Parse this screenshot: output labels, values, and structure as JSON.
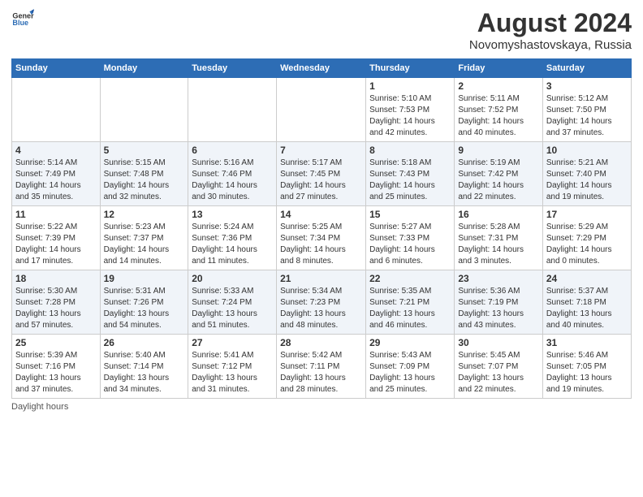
{
  "header": {
    "logo_line1": "General",
    "logo_line2": "Blue",
    "month_year": "August 2024",
    "location": "Novomyshastovskaya, Russia"
  },
  "days_of_week": [
    "Sunday",
    "Monday",
    "Tuesday",
    "Wednesday",
    "Thursday",
    "Friday",
    "Saturday"
  ],
  "weeks": [
    [
      {
        "day": "",
        "info": ""
      },
      {
        "day": "",
        "info": ""
      },
      {
        "day": "",
        "info": ""
      },
      {
        "day": "",
        "info": ""
      },
      {
        "day": "1",
        "info": "Sunrise: 5:10 AM\nSunset: 7:53 PM\nDaylight: 14 hours\nand 42 minutes."
      },
      {
        "day": "2",
        "info": "Sunrise: 5:11 AM\nSunset: 7:52 PM\nDaylight: 14 hours\nand 40 minutes."
      },
      {
        "day": "3",
        "info": "Sunrise: 5:12 AM\nSunset: 7:50 PM\nDaylight: 14 hours\nand 37 minutes."
      }
    ],
    [
      {
        "day": "4",
        "info": "Sunrise: 5:14 AM\nSunset: 7:49 PM\nDaylight: 14 hours\nand 35 minutes."
      },
      {
        "day": "5",
        "info": "Sunrise: 5:15 AM\nSunset: 7:48 PM\nDaylight: 14 hours\nand 32 minutes."
      },
      {
        "day": "6",
        "info": "Sunrise: 5:16 AM\nSunset: 7:46 PM\nDaylight: 14 hours\nand 30 minutes."
      },
      {
        "day": "7",
        "info": "Sunrise: 5:17 AM\nSunset: 7:45 PM\nDaylight: 14 hours\nand 27 minutes."
      },
      {
        "day": "8",
        "info": "Sunrise: 5:18 AM\nSunset: 7:43 PM\nDaylight: 14 hours\nand 25 minutes."
      },
      {
        "day": "9",
        "info": "Sunrise: 5:19 AM\nSunset: 7:42 PM\nDaylight: 14 hours\nand 22 minutes."
      },
      {
        "day": "10",
        "info": "Sunrise: 5:21 AM\nSunset: 7:40 PM\nDaylight: 14 hours\nand 19 minutes."
      }
    ],
    [
      {
        "day": "11",
        "info": "Sunrise: 5:22 AM\nSunset: 7:39 PM\nDaylight: 14 hours\nand 17 minutes."
      },
      {
        "day": "12",
        "info": "Sunrise: 5:23 AM\nSunset: 7:37 PM\nDaylight: 14 hours\nand 14 minutes."
      },
      {
        "day": "13",
        "info": "Sunrise: 5:24 AM\nSunset: 7:36 PM\nDaylight: 14 hours\nand 11 minutes."
      },
      {
        "day": "14",
        "info": "Sunrise: 5:25 AM\nSunset: 7:34 PM\nDaylight: 14 hours\nand 8 minutes."
      },
      {
        "day": "15",
        "info": "Sunrise: 5:27 AM\nSunset: 7:33 PM\nDaylight: 14 hours\nand 6 minutes."
      },
      {
        "day": "16",
        "info": "Sunrise: 5:28 AM\nSunset: 7:31 PM\nDaylight: 14 hours\nand 3 minutes."
      },
      {
        "day": "17",
        "info": "Sunrise: 5:29 AM\nSunset: 7:29 PM\nDaylight: 14 hours\nand 0 minutes."
      }
    ],
    [
      {
        "day": "18",
        "info": "Sunrise: 5:30 AM\nSunset: 7:28 PM\nDaylight: 13 hours\nand 57 minutes."
      },
      {
        "day": "19",
        "info": "Sunrise: 5:31 AM\nSunset: 7:26 PM\nDaylight: 13 hours\nand 54 minutes."
      },
      {
        "day": "20",
        "info": "Sunrise: 5:33 AM\nSunset: 7:24 PM\nDaylight: 13 hours\nand 51 minutes."
      },
      {
        "day": "21",
        "info": "Sunrise: 5:34 AM\nSunset: 7:23 PM\nDaylight: 13 hours\nand 48 minutes."
      },
      {
        "day": "22",
        "info": "Sunrise: 5:35 AM\nSunset: 7:21 PM\nDaylight: 13 hours\nand 46 minutes."
      },
      {
        "day": "23",
        "info": "Sunrise: 5:36 AM\nSunset: 7:19 PM\nDaylight: 13 hours\nand 43 minutes."
      },
      {
        "day": "24",
        "info": "Sunrise: 5:37 AM\nSunset: 7:18 PM\nDaylight: 13 hours\nand 40 minutes."
      }
    ],
    [
      {
        "day": "25",
        "info": "Sunrise: 5:39 AM\nSunset: 7:16 PM\nDaylight: 13 hours\nand 37 minutes."
      },
      {
        "day": "26",
        "info": "Sunrise: 5:40 AM\nSunset: 7:14 PM\nDaylight: 13 hours\nand 34 minutes."
      },
      {
        "day": "27",
        "info": "Sunrise: 5:41 AM\nSunset: 7:12 PM\nDaylight: 13 hours\nand 31 minutes."
      },
      {
        "day": "28",
        "info": "Sunrise: 5:42 AM\nSunset: 7:11 PM\nDaylight: 13 hours\nand 28 minutes."
      },
      {
        "day": "29",
        "info": "Sunrise: 5:43 AM\nSunset: 7:09 PM\nDaylight: 13 hours\nand 25 minutes."
      },
      {
        "day": "30",
        "info": "Sunrise: 5:45 AM\nSunset: 7:07 PM\nDaylight: 13 hours\nand 22 minutes."
      },
      {
        "day": "31",
        "info": "Sunrise: 5:46 AM\nSunset: 7:05 PM\nDaylight: 13 hours\nand 19 minutes."
      }
    ]
  ],
  "footer": {
    "daylight_label": "Daylight hours"
  }
}
